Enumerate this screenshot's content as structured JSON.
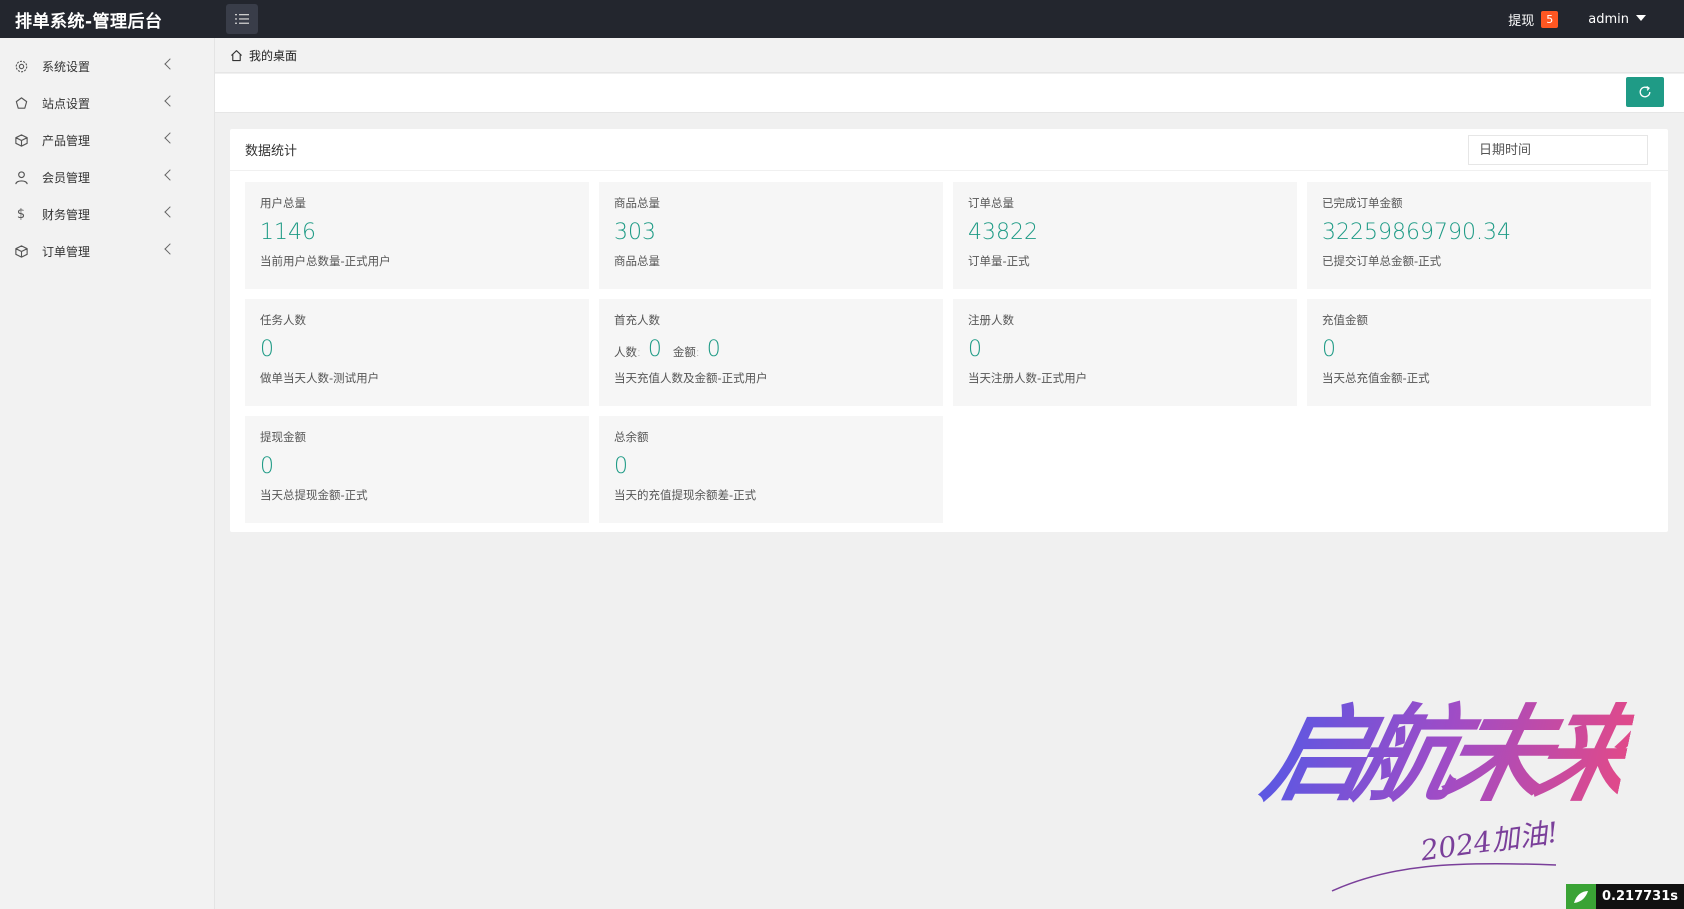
{
  "header": {
    "title": "排单系统-管理后台",
    "menu_toggle_icon": "list-icon",
    "withdraw_label": "提现",
    "withdraw_badge": "5",
    "user_name": "admin"
  },
  "sidebar": {
    "items": [
      {
        "label": "系统设置",
        "icon": "gear-icon"
      },
      {
        "label": "站点设置",
        "icon": "cycle-icon"
      },
      {
        "label": "产品管理",
        "icon": "box-icon"
      },
      {
        "label": "会员管理",
        "icon": "user-icon"
      },
      {
        "label": "财务管理",
        "icon": "dollar-icon"
      },
      {
        "label": "订单管理",
        "icon": "box-icon"
      }
    ]
  },
  "breadcrumb": {
    "icon": "home-icon",
    "label": "我的桌面"
  },
  "toolbar": {
    "refresh_icon": "refresh-icon"
  },
  "stats_panel": {
    "title": "数据统计",
    "date_placeholder": "日期时间",
    "cards": [
      {
        "title": "用户总量",
        "value": "1146",
        "sub": "当前用户总数量-正式用户"
      },
      {
        "title": "商品总量",
        "value": "303",
        "sub": "商品总量"
      },
      {
        "title": "订单总量",
        "value": "43822",
        "sub": "订单量-正式"
      },
      {
        "title": "已完成订单金额",
        "value": "32259869790.34",
        "sub": "已提交订单总金额-正式"
      },
      {
        "title": "任务人数",
        "value": "0",
        "sub": "做单当天人数-测试用户"
      },
      {
        "title": "首充人数",
        "count_label": "人数:",
        "count_value": "0",
        "amount_label": "金额:",
        "amount_value": "0",
        "sub": "当天充值人数及金额-正式用户"
      },
      {
        "title": "注册人数",
        "value": "0",
        "sub": "当天注册人数-正式用户"
      },
      {
        "title": "充值金额",
        "value": "0",
        "sub": "当天总充值金额-正式"
      },
      {
        "title": "提现金额",
        "value": "0",
        "sub": "当天总提现金额-正式"
      },
      {
        "title": "总余额",
        "value": "0",
        "sub": "当天的充值提现余额差-正式"
      }
    ]
  },
  "watermark": {
    "main": "启航未来",
    "sub": "2024加油!"
  },
  "timer": {
    "value": "0.217731s"
  },
  "colors": {
    "header_bg": "#23262e",
    "accent": "#1f9b86",
    "badge": "#ff5722"
  }
}
